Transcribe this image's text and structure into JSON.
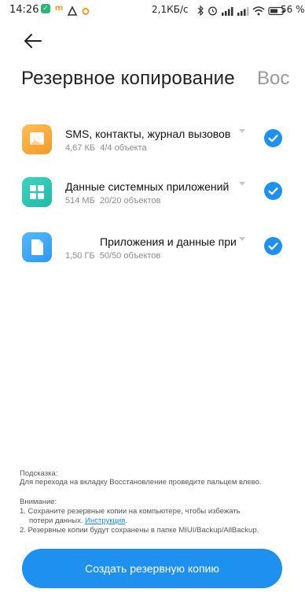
{
  "status_bar": {
    "time": "14:26",
    "net_speed": "2,1КБ/с",
    "battery_percent": "56",
    "battery_suffix": "%",
    "app_icons": [
      "shield-app-icon",
      "m-app-icon",
      "delta-app-icon",
      "alarm-app-icon"
    ],
    "system_icons": [
      "bluetooth-icon",
      "alarm-clock-icon",
      "signal-1-icon",
      "signal-2-icon",
      "wifi-icon",
      "battery-icon"
    ]
  },
  "header": {
    "back_icon": "arrow-left-icon",
    "title": "Резервное копирование",
    "next_tab_partial": "Вос"
  },
  "items": [
    {
      "icon": "message-icon",
      "icon_color": "#f7a93a",
      "title": "SMS, контакты, журнал вызовов",
      "size": "4,67 КБ",
      "count": "4/4 объекта",
      "checked": true
    },
    {
      "icon": "grid-icon",
      "icon_color": "#27c2b0",
      "title": "Данные системных приложений",
      "size": "514 МБ",
      "count": "20/20 объектов",
      "checked": true
    },
    {
      "icon": "document-icon",
      "icon_color": "#3aa6f5",
      "title": "Приложения и данные при",
      "size": "1,50 ГБ",
      "count": "50/50 объектов",
      "checked": true
    }
  ],
  "hint": {
    "tip_label": "Подсказка:",
    "tip_text": "Для перехода на вкладку Восстановление проведите пальцем влево.",
    "warning_label": "Внимание:",
    "warning_1a": "1. Сохраните резервные копии на компьютере, чтобы избежать",
    "warning_1b": "потери данных.",
    "warning_link": "Инструкция",
    "warning_1_end": ".",
    "warning_2": "2. Резервные копии будут сохранены в папке MIUI/Backup/AllBackup."
  },
  "primary_button": "Создать резервную копию",
  "colors": {
    "accent": "#1e90f0",
    "link": "#1e87e6"
  }
}
